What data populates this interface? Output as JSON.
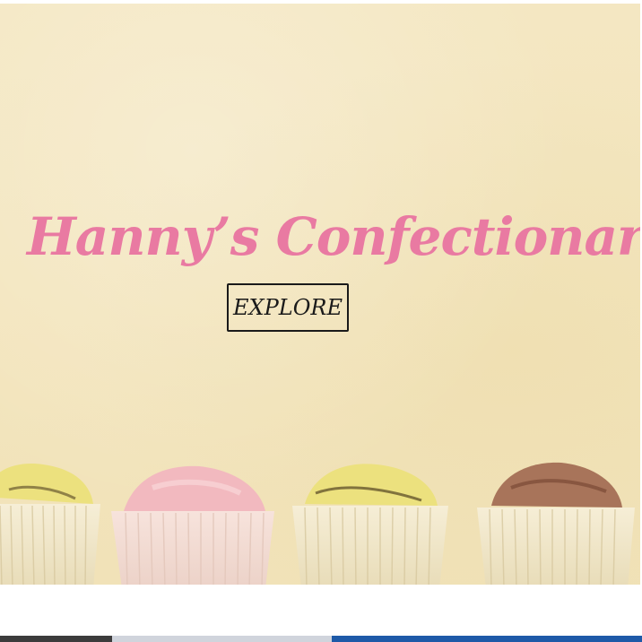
{
  "hero": {
    "title": "Hanny’s Confectionary",
    "explore_label": "EXPLORE"
  },
  "colors": {
    "title": "#e97aa2",
    "background": "#f4e7c2",
    "button_border": "#1a1a1a"
  }
}
